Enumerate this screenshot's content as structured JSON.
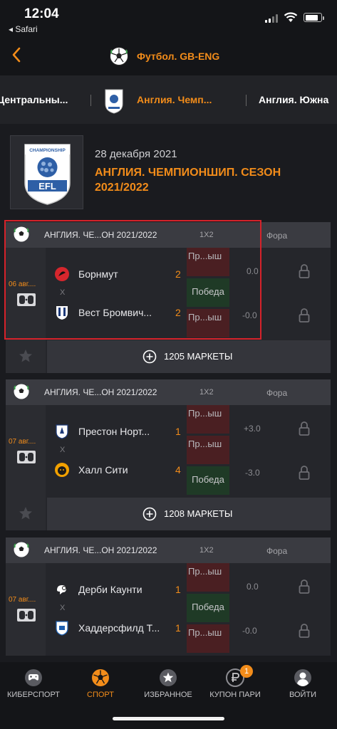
{
  "status": {
    "time": "12:04",
    "back_app": "◂ Safari"
  },
  "header": {
    "title": "Футбол. GB-ENG"
  },
  "tabs": [
    {
      "label": "Центральны..."
    },
    {
      "label": "Англия. Чемп..."
    },
    {
      "label": "Англия. Южна"
    }
  ],
  "league": {
    "date": "28 декабря 2021",
    "name": "АНГЛИЯ. ЧЕМПИОНШИП. СЕЗОН 2021/2022",
    "logo_text": {
      "top": "CHAMPIONSHIP",
      "bottom": "EFL"
    }
  },
  "events": [
    {
      "league": "АНГЛИЯ. ЧЕ...ОН 2021/2022",
      "col_1x2": "1X2",
      "col_fora": "Фора",
      "date": "06 авг....",
      "vs": "X",
      "home": {
        "name": "Борнмут",
        "score": "2"
      },
      "away": {
        "name": "Вест Бромвич...",
        "score": "2"
      },
      "odds": [
        "Пр...ыш",
        "Победа",
        "Пр...ыш"
      ],
      "fora": [
        "0.0",
        "-0.0"
      ],
      "markets": "1205 МАРКЕТЫ"
    },
    {
      "league": "АНГЛИЯ. ЧЕ...ОН 2021/2022",
      "col_1x2": "1X2",
      "col_fora": "Фора",
      "date": "07 авг....",
      "vs": "X",
      "home": {
        "name": "Престон Норт...",
        "score": "1"
      },
      "away": {
        "name": "Халл Сити",
        "score": "4"
      },
      "odds": [
        "Пр...ыш",
        "Пр...ыш",
        "Победа"
      ],
      "fora": [
        "+3.0",
        "-3.0"
      ],
      "markets": "1208 МАРКЕТЫ"
    },
    {
      "league": "АНГЛИЯ. ЧЕ...ОН 2021/2022",
      "col_1x2": "1X2",
      "col_fora": "Фора",
      "date": "07 авг....",
      "vs": "X",
      "home": {
        "name": "Дерби Каунти",
        "score": "1"
      },
      "away": {
        "name": "Хаддерсфилд Т...",
        "score": "1"
      },
      "odds": [
        "Пр...ыш",
        "Победа",
        "Пр...ыш"
      ],
      "fora": [
        "0.0",
        "-0.0"
      ]
    }
  ],
  "nav": [
    {
      "label": "КИБЕРСПОРТ"
    },
    {
      "label": "СПОРТ"
    },
    {
      "label": "ИЗБРАННОЕ"
    },
    {
      "label": "КУПОН ПАРИ",
      "badge": "1"
    },
    {
      "label": "ВОЙТИ"
    }
  ],
  "colors": {
    "accent": "#f28c1a",
    "bg": "#1a1b1f",
    "highlight": "#d6222a"
  }
}
